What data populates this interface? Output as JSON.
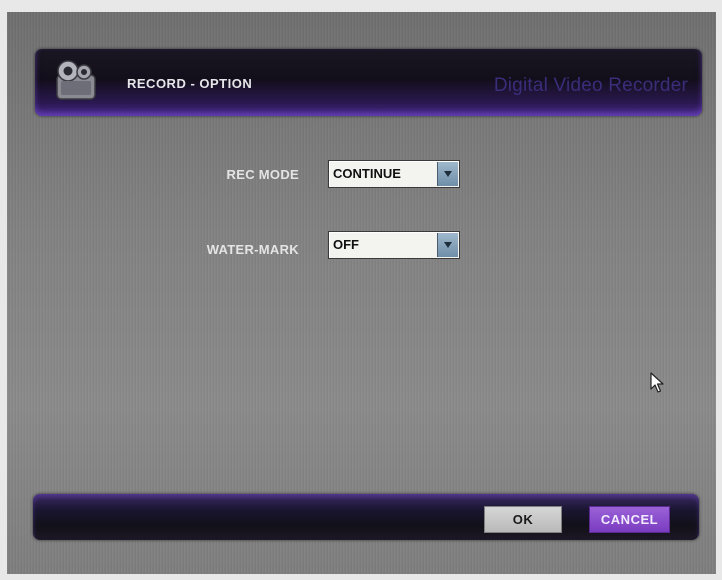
{
  "header": {
    "title": "RECORD - OPTION",
    "brand": "Digital Video Recorder",
    "icon": "camera-icon"
  },
  "form": {
    "rec_mode": {
      "label": "REC MODE",
      "value": "CONTINUE"
    },
    "water_mark": {
      "label": "WATER-MARK",
      "value": "OFF"
    }
  },
  "footer": {
    "ok_label": "OK",
    "cancel_label": "CANCEL"
  },
  "colors": {
    "accent": "#7a3cc0",
    "title_bar": "#120e1a",
    "brand_text": "#3a2d7a",
    "background": "#828282"
  }
}
